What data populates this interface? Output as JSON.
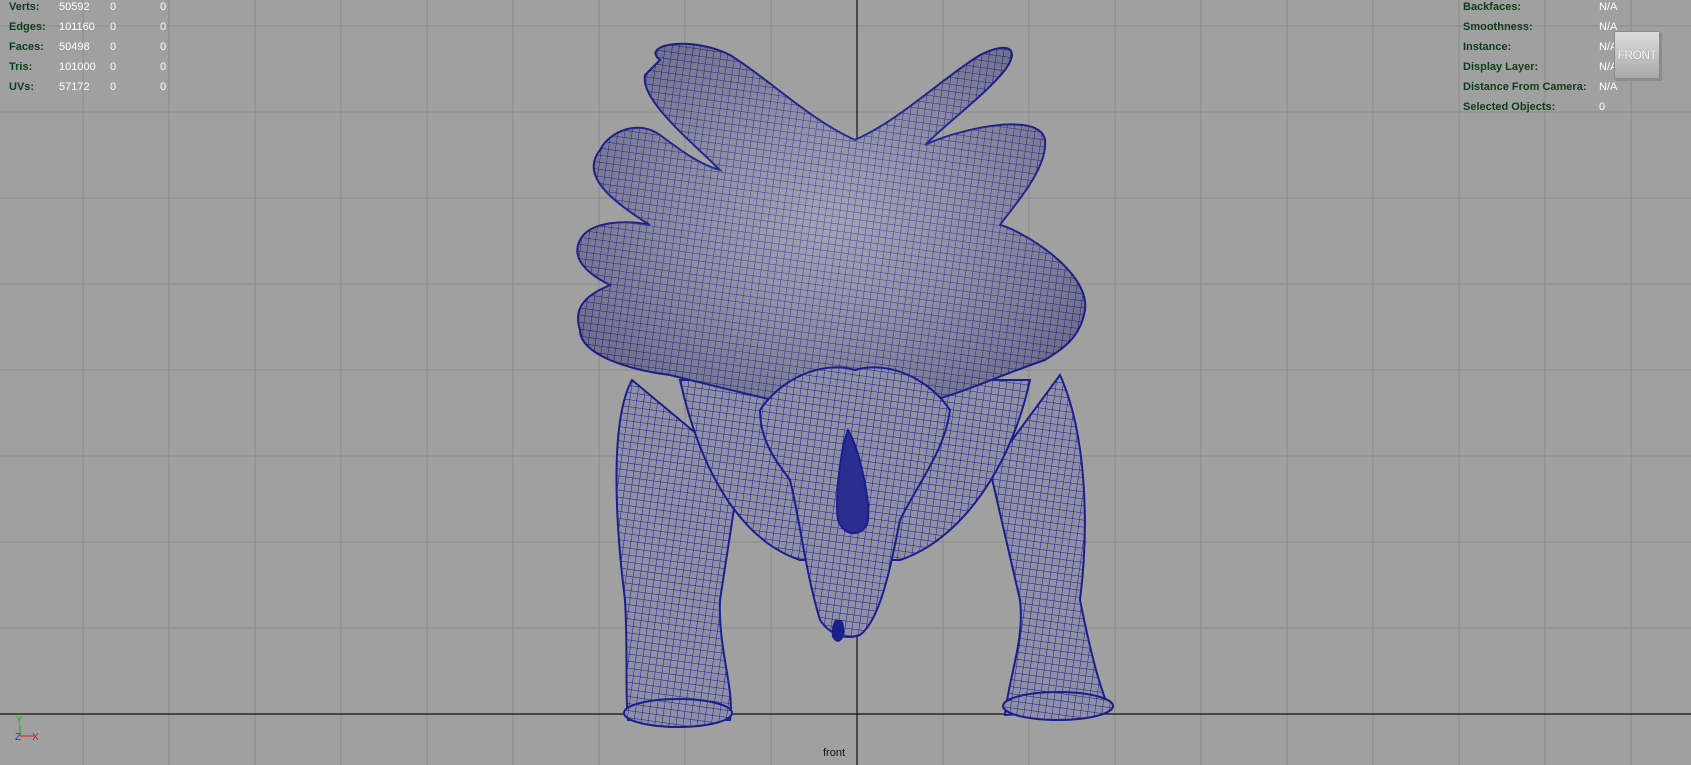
{
  "hud_left": {
    "rows": [
      {
        "label": "Verts:",
        "v1": "50592",
        "v2": "0",
        "v3": "0"
      },
      {
        "label": "Edges:",
        "v1": "101160",
        "v2": "0",
        "v3": "0"
      },
      {
        "label": "Faces:",
        "v1": "50498",
        "v2": "0",
        "v3": "0"
      },
      {
        "label": "Tris:",
        "v1": "101000",
        "v2": "0",
        "v3": "0"
      },
      {
        "label": "UVs:",
        "v1": "57172",
        "v2": "0",
        "v3": "0"
      }
    ]
  },
  "hud_right": {
    "rows": [
      {
        "label": "Backfaces:",
        "value": "N/A"
      },
      {
        "label": "Smoothness:",
        "value": "N/A"
      },
      {
        "label": "Instance:",
        "value": "N/A"
      },
      {
        "label": "Display Layer:",
        "value": "N/A"
      },
      {
        "label": "Distance From Camera:",
        "value": "N/A"
      },
      {
        "label": "Selected Objects:",
        "value": "0"
      }
    ]
  },
  "view_cube": {
    "label": "FRONT"
  },
  "camera": {
    "name": "front"
  },
  "axis": {
    "y": "Y",
    "z": "Z",
    "x": "X"
  },
  "colors": {
    "background": "#a0a0a0",
    "grid": "#8a8a8a",
    "grid_axis": "#111111",
    "wireframe": "#1b1f8c",
    "hud_label": "#0d3d1a",
    "hud_value": "#ffffff",
    "axis_x": "#d02020",
    "axis_y": "#20b020",
    "axis_z": "#2040d0"
  }
}
